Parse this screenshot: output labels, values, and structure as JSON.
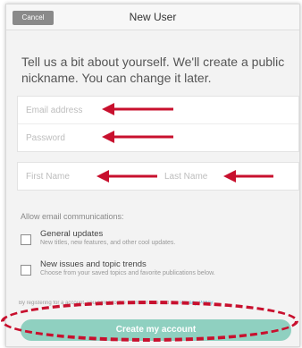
{
  "window": {
    "title": "New User",
    "cancel_label": "Cancel"
  },
  "intro_text": "Tell us a bit about yourself. We'll create a public nickname. You can change it later.",
  "fields": {
    "email_placeholder": "Email address",
    "password_placeholder": "Password",
    "first_name_placeholder": "First Name",
    "last_name_placeholder": "Last Name"
  },
  "email_communications": {
    "label": "Allow email communications:",
    "options": [
      {
        "title": "General updates",
        "description": "New titles, new features, and other cool updates.",
        "checked": false
      },
      {
        "title": "New issues and topic trends",
        "description": "Choose from your saved topics and favorite publications below.",
        "checked": false
      }
    ]
  },
  "terms": {
    "prefix": "By registering for a ",
    "middle": "account, you agree to the Terms of Use",
    "and": " and the ",
    "privacy_link": "Privacy Policy"
  },
  "create_button_label": "Create my account",
  "colors": {
    "annotation_red": "#c8102e",
    "create_button": "#8fd0c0",
    "cancel_button": "#8a8a8a",
    "link": "#59b5d0"
  }
}
